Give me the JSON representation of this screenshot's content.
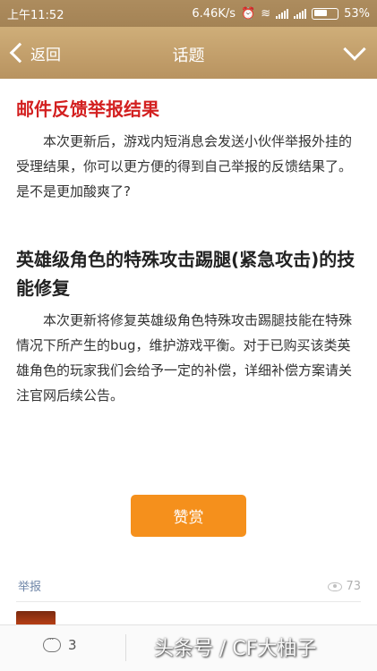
{
  "status_bar": {
    "time": "上午11:52",
    "speed": "6.46K/s",
    "battery": "53%",
    "icons": [
      "alarm-icon",
      "wifi-icon",
      "signal-icon",
      "signal-icon",
      "battery-icon"
    ]
  },
  "nav": {
    "back_label": "返回",
    "title": "话题",
    "menu_icon": "chevron-down-icon"
  },
  "article": {
    "section1_title": "邮件反馈举报结果",
    "section1_body": "本次更新后，游戏内短消息会发送小伙伴举报外挂的受理结果，你可以更方便的得到自己举报的反馈结果了。是不是更加酸爽了?",
    "section2_title": "英雄级角色的特殊攻击踢腿(紧急攻击)的技能修复",
    "section2_body": "本次更新将修复英雄级角色特殊攻击踢腿技能在特殊情况下所产生的bug，维护游戏平衡。对于已购买该类英雄角色的玩家我们会给予一定的补偿，详细补偿方案请关注官网后续公告。"
  },
  "reward_button_label": "赞赏",
  "footer": {
    "report_label": "举报",
    "view_count": "73"
  },
  "bottom_bar": {
    "comment_count": "3",
    "watermark": "头条号 / CF大柚子"
  },
  "colors": {
    "accent_red": "#d32020",
    "reward_orange": "#f5901c",
    "nav_gold": "#c4a16c"
  }
}
